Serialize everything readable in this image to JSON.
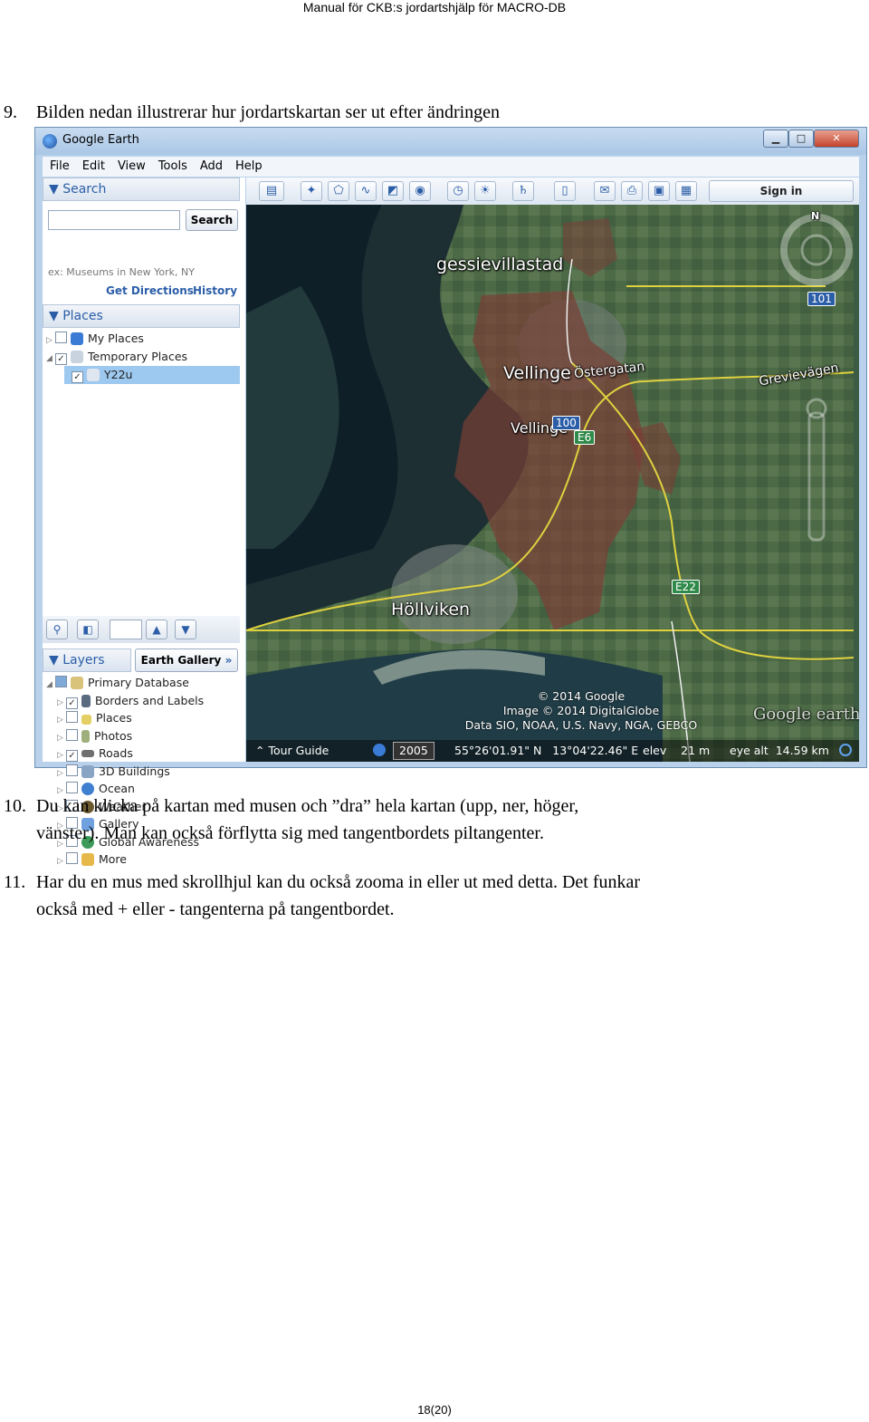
{
  "header": "Manual för CKB:s jordartshjälp för MACRO-DB",
  "steps": [
    {
      "num": "9.",
      "line1": "Bilden nedan illustrerar hur jordartskartan ser ut efter ändringen"
    },
    {
      "num": "10.",
      "line1": "Du kan klicka på kartan med musen och ”dra” hela kartan (upp, ner, höger,",
      "line2": "vänster). Man kan också förflytta sig med tangentbordets piltangenter."
    },
    {
      "num": "11.",
      "line1": "Har du en mus med skrollhjul kan du också zooma in eller ut med detta. Det funkar",
      "line2": "också med + eller - tangenterna på tangentbordet."
    }
  ],
  "footer": "18(20)",
  "app": {
    "title": "Google Earth",
    "menu": [
      "File",
      "Edit",
      "View",
      "Tools",
      "Add",
      "Help"
    ],
    "search": {
      "header": "Search",
      "button": "Search",
      "hint": "ex: Museums in New York, NY",
      "get_directions": "Get Directions",
      "history": "History"
    },
    "places": {
      "header": "Places",
      "items": [
        {
          "label": "My Places",
          "checked": false
        },
        {
          "label": "Temporary Places",
          "checked": true
        },
        {
          "label": "Y22u",
          "checked": true,
          "selected": true
        }
      ]
    },
    "layers": {
      "header": "Layers",
      "gallery_button": "Earth Gallery",
      "items": [
        {
          "label": "Primary Database",
          "checked": false
        },
        {
          "label": "Borders and Labels",
          "checked": true
        },
        {
          "label": "Places",
          "checked": false
        },
        {
          "label": "Photos",
          "checked": false
        },
        {
          "label": "Roads",
          "checked": true
        },
        {
          "label": "3D Buildings",
          "checked": false
        },
        {
          "label": "Ocean",
          "checked": false
        },
        {
          "label": "Weather",
          "checked": false
        },
        {
          "label": "Gallery",
          "checked": false
        },
        {
          "label": "Global Awareness",
          "checked": false
        },
        {
          "label": "More",
          "checked": false
        }
      ]
    },
    "toolbar": {
      "sign_in": "Sign in"
    },
    "map": {
      "labels": {
        "gessie": "gessievillastad",
        "vellinge": "Vellinge",
        "ostergatan": "Östergatan",
        "vellinge2": "Vellinge",
        "grevievagen": "Grevievägen",
        "hollviken": "Höllviken"
      },
      "shields": {
        "r101": "101",
        "r100": "100",
        "e6": "E6",
        "e22": "E22"
      },
      "compass_north": "N",
      "credits": [
        "© 2014 Google",
        "Image © 2014 DigitalGlobe",
        "Data SIO, NOAA, U.S. Navy, NGA, GEBCO"
      ],
      "logo": "Google earth",
      "status": {
        "tour_guide": "Tour Guide",
        "year": "2005",
        "coords": "55°26'01.91\" N   13°04'22.46\" E",
        "elev": "elev    21 m",
        "eye_alt": "eye alt  14.59 km"
      }
    }
  }
}
